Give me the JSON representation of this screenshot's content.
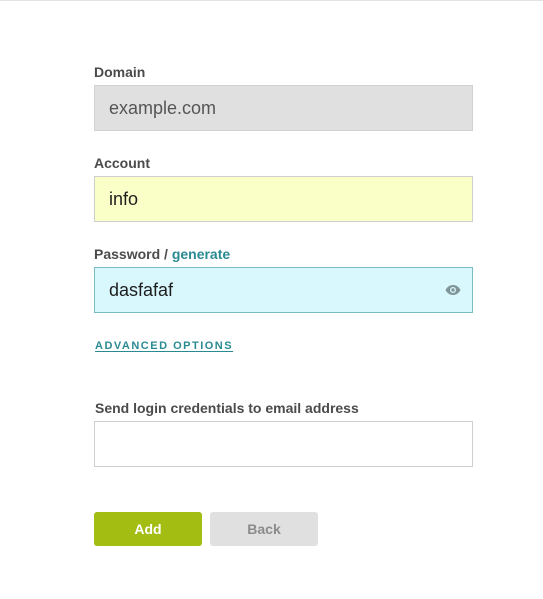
{
  "form": {
    "domain": {
      "label": "Domain",
      "value": "example.com"
    },
    "account": {
      "label": "Account",
      "value": "info"
    },
    "password": {
      "label": "Password / ",
      "generate_link": "generate",
      "value": "dasfafaf",
      "reveal_icon": "eye-icon"
    },
    "advanced_options": "ADVANCED OPTIONS",
    "email": {
      "label": "Send login credentials to email address",
      "value": ""
    },
    "buttons": {
      "add": "Add",
      "back": "Back"
    }
  },
  "colors": {
    "accent_teal": "#2a8a92",
    "add_button": "#a3bd12",
    "account_field_bg": "#f9ffc6",
    "password_field_bg": "#d9f8fd",
    "domain_field_bg": "#e0e0e0"
  }
}
